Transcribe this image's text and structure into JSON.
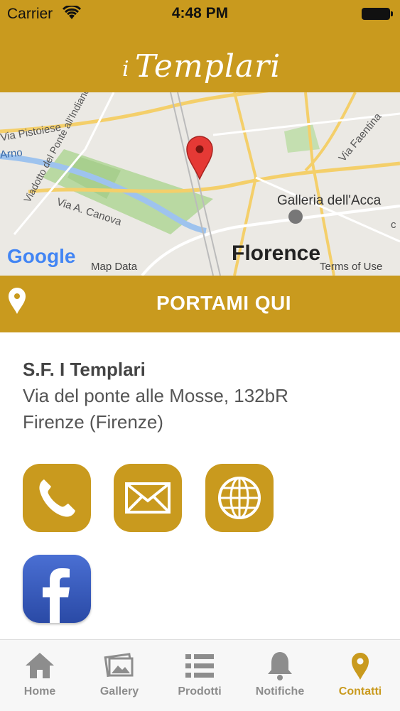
{
  "status_bar": {
    "carrier": "Carrier",
    "time": "4:48 PM"
  },
  "header": {
    "logo_prefix": "i",
    "logo_text": "Templari"
  },
  "map": {
    "labels": {
      "via_pistoiese": "Via Pistoiese",
      "arno": "Arno",
      "viadotto": "Viadotto del Ponte all'Indiano",
      "via_canova": "Via A. Canova",
      "via_faentina": "Via Faentina",
      "galleria": "Galleria dell'Acca",
      "c": "c",
      "florence": "Florence",
      "google": "Google",
      "map_data": "Map Data",
      "terms": "Terms of Use"
    }
  },
  "banner": {
    "label": "PORTAMI QUI"
  },
  "info": {
    "name": "S.F. I Templari",
    "address": "Via del ponte alle Mosse, 132bR",
    "city": "Firenze (Firenze)"
  },
  "contact_buttons": [
    "phone-icon",
    "mail-icon",
    "globe-icon",
    "facebook-icon"
  ],
  "tabs": [
    {
      "label": "Home",
      "icon": "home-icon"
    },
    {
      "label": "Gallery",
      "icon": "gallery-icon"
    },
    {
      "label": "Prodotti",
      "icon": "list-icon"
    },
    {
      "label": "Notifiche",
      "icon": "bell-icon"
    },
    {
      "label": "Contatti",
      "icon": "location-icon",
      "active": true
    }
  ],
  "colors": {
    "brand": "#c99a1e",
    "facebook": "#3b5bbd",
    "inactive": "#8d8d8d"
  }
}
